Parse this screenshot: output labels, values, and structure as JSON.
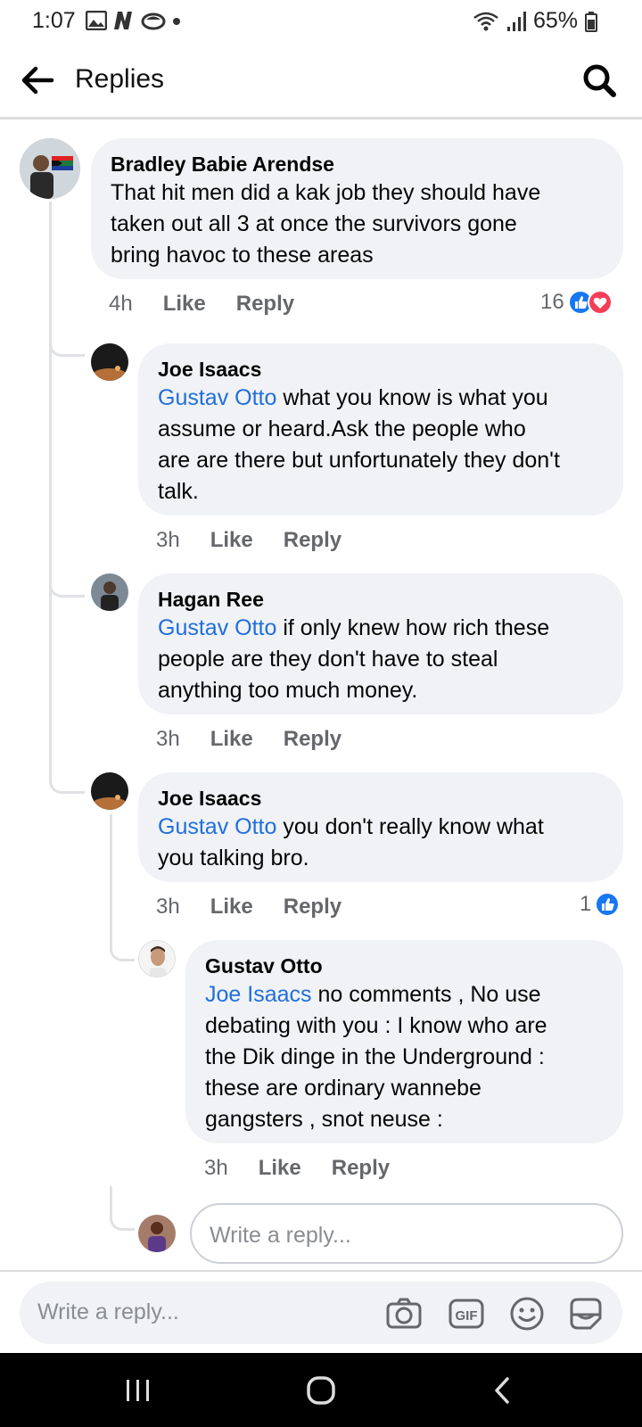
{
  "status_bar": {
    "time": "1:07",
    "battery": "65%"
  },
  "header": {
    "title": "Replies"
  },
  "comments": [
    {
      "author": "Bradley Babie Arendse",
      "lines": [
        "That hit men did a kak job they should have",
        "taken out all 3 at once the survivors gone",
        "bring havoc to these areas"
      ],
      "time": "4h",
      "like": "Like",
      "reply": "Reply",
      "reaction_count": "16"
    },
    {
      "author": "Joe Isaacs",
      "mention": "Gustav Otto",
      "lines": [
        " what you know is what you",
        "assume or heard.Ask the people who",
        "are are there but unfortunately they don't",
        "talk."
      ],
      "time": "3h",
      "like": "Like",
      "reply": "Reply"
    },
    {
      "author": "Hagan Ree",
      "mention": "Gustav Otto",
      "lines": [
        " if only knew how rich these",
        "people are they don't have to steal",
        "anything too much money."
      ],
      "time": "3h",
      "like": "Like",
      "reply": "Reply"
    },
    {
      "author": "Joe Isaacs",
      "mention": "Gustav Otto",
      "lines": [
        " you don't really know what",
        "you talking bro."
      ],
      "time": "3h",
      "like": "Like",
      "reply": "Reply",
      "reaction_count": "1"
    },
    {
      "author": "Gustav Otto",
      "mention": "Joe Isaacs",
      "lines": [
        " no comments , No use",
        "debating with you : I know who are",
        "the Dik dinge in the Underground :",
        "these are ordinary wannebe",
        "gangsters , snot neuse :"
      ],
      "time": "3h",
      "like": "Like",
      "reply": "Reply"
    }
  ],
  "inline_reply": {
    "placeholder": "Write a reply..."
  },
  "composer": {
    "placeholder": "Write a reply..."
  },
  "colors": {
    "mention": "#216fdb",
    "like_blue": "#1877f2",
    "love_red": "#f33e58",
    "bubble": "#f0f2f5"
  },
  "icons": [
    "back-arrow-icon",
    "search-icon",
    "camera-icon",
    "gif-icon",
    "emoji-icon",
    "sticker-icon"
  ]
}
